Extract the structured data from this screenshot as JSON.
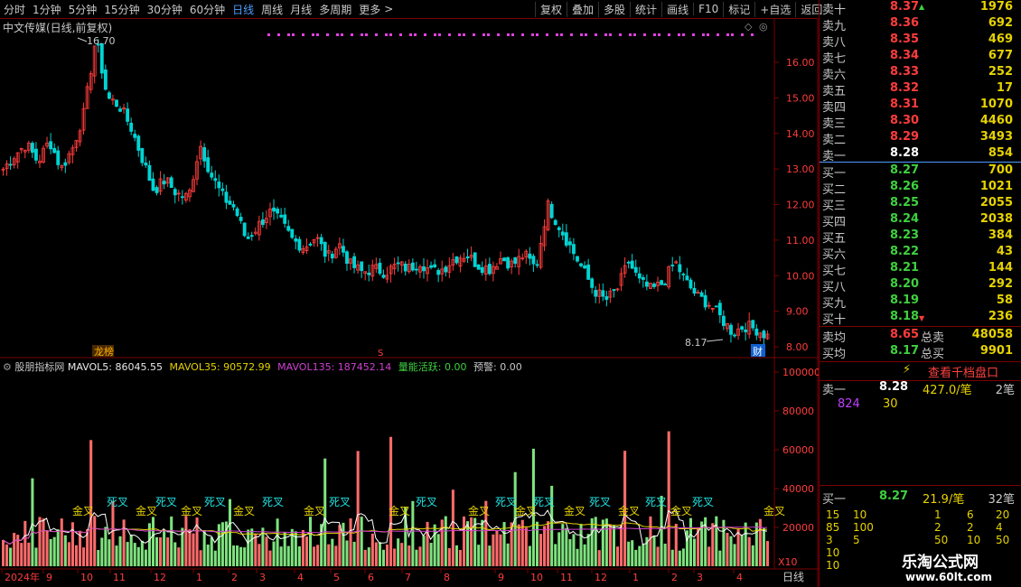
{
  "toolbar": {
    "periods": [
      "分时",
      "1分钟",
      "5分钟",
      "15分钟",
      "30分钟",
      "60分钟",
      "日线",
      "周线",
      "月线",
      "多周期",
      "更多"
    ],
    "active_period": "日线",
    "tools": [
      "复权",
      "叠加",
      "多股",
      "统计",
      "画线",
      "F10",
      "标记",
      "+自选",
      "返回"
    ]
  },
  "kline": {
    "title": "中文传媒(日线,前复权)",
    "max_label": "16.70",
    "min_label": "8.17",
    "badge_left": "龙榜",
    "badge_fin": "财",
    "badge_s": "S"
  },
  "indicator": {
    "name": "股朋指标网",
    "mavol5_label": "MAVOL5:",
    "mavol5": "86045.55",
    "mavol35_label": "MAVOL35:",
    "mavol35": "90572.99",
    "mavol135_label": "MAVOL135:",
    "mavol135": "187452.14",
    "active_label": "量能活跃:",
    "active": "0.00",
    "warn_label": "预警:",
    "warn": "0.00",
    "unit": "X10",
    "cross_gold": "金叉",
    "cross_dead": "死叉"
  },
  "axis": {
    "price_ticks": [
      "16.00",
      "15.00",
      "14.00",
      "13.00",
      "12.00",
      "11.00",
      "10.00",
      "9.00",
      "8.00"
    ],
    "vol_ticks": [
      "100000",
      "80000",
      "60000",
      "40000",
      "20000"
    ],
    "months": [
      "2024年",
      "9",
      "10",
      "11",
      "12",
      "1",
      "2",
      "3",
      "4",
      "5",
      "6",
      "7",
      "8",
      "9",
      "10",
      "11",
      "12",
      "1",
      "2",
      "3",
      "4"
    ],
    "bottom_label": "日线"
  },
  "orderbook": {
    "asks": [
      {
        "label": "卖十",
        "price": "8.37",
        "vol": "1976"
      },
      {
        "label": "卖九",
        "price": "8.36",
        "vol": "692"
      },
      {
        "label": "卖八",
        "price": "8.35",
        "vol": "469"
      },
      {
        "label": "卖七",
        "price": "8.34",
        "vol": "677"
      },
      {
        "label": "卖六",
        "price": "8.33",
        "vol": "252"
      },
      {
        "label": "卖五",
        "price": "8.32",
        "vol": "17"
      },
      {
        "label": "卖四",
        "price": "8.31",
        "vol": "1070"
      },
      {
        "label": "卖三",
        "price": "8.30",
        "vol": "4460"
      },
      {
        "label": "卖二",
        "price": "8.29",
        "vol": "3493"
      },
      {
        "label": "卖一",
        "price": "8.28",
        "vol": "854"
      }
    ],
    "bids": [
      {
        "label": "买一",
        "price": "8.27",
        "vol": "700"
      },
      {
        "label": "买二",
        "price": "8.26",
        "vol": "1021"
      },
      {
        "label": "买三",
        "price": "8.25",
        "vol": "2055"
      },
      {
        "label": "买四",
        "price": "8.24",
        "vol": "2038"
      },
      {
        "label": "买五",
        "price": "8.23",
        "vol": "384"
      },
      {
        "label": "买六",
        "price": "8.22",
        "vol": "43"
      },
      {
        "label": "买七",
        "price": "8.21",
        "vol": "144"
      },
      {
        "label": "买八",
        "price": "8.20",
        "vol": "292"
      },
      {
        "label": "买九",
        "price": "8.19",
        "vol": "58"
      },
      {
        "label": "买十",
        "price": "8.18",
        "vol": "236"
      }
    ],
    "avg_ask_label": "卖均",
    "avg_ask": "8.65",
    "total_ask_label": "总卖",
    "total_ask": "48058",
    "avg_bid_label": "买均",
    "avg_bid": "8.17",
    "total_bid_label": "总买",
    "total_bid": "9901",
    "look_button": "查看千档盘口",
    "sell1_label": "卖一",
    "sell1_price": "8.28",
    "sell1_detail": "427.0/笔",
    "sell1_count": "2笔",
    "sell1_q1": "824",
    "sell1_q2": "30",
    "buy1_label": "买一",
    "buy1_price": "8.27",
    "buy1_detail": "21.9/笔",
    "buy1_count": "32笔"
  },
  "ticks": [
    [
      "15",
      "10",
      "1",
      "6",
      "20"
    ],
    [
      "85",
      "100",
      "2",
      "2",
      "4"
    ],
    [
      "3",
      "5",
      "50",
      "10",
      "50"
    ],
    [
      "10"
    ],
    [
      "10"
    ]
  ],
  "watermark": {
    "name": "乐淘公式网",
    "url": "www.60lt.com"
  },
  "colors": {
    "up": "#ff3c3c",
    "down": "#00d4d4",
    "volup": "#ff6b6b",
    "voldown": "#7ee37e",
    "accent": "#4f9cff",
    "frame": "#7a0000"
  },
  "chart_data": {
    "type": "bar",
    "kline_close_path": [
      13.0,
      13.4,
      13.7,
      13.2,
      13.8,
      13.0,
      13.6,
      14.6,
      16.7,
      15.0,
      14.8,
      14.2,
      13.3,
      12.4,
      12.7,
      12.3,
      12.2,
      13.7,
      12.8,
      12.2,
      11.9,
      11.0,
      11.4,
      11.8,
      11.5,
      11.0,
      10.8,
      11.1,
      10.5,
      10.9,
      10.3,
      10.1,
      10.2,
      10.1,
      10.3,
      10.2,
      10.4,
      10.1,
      10.2,
      10.5,
      10.6,
      10.3,
      10.2,
      10.5,
      10.3,
      10.6,
      10.2,
      12.0,
      11.4,
      10.8,
      10.2,
      9.6,
      9.3,
      9.6,
      10.4,
      9.8,
      9.6,
      9.8,
      10.4,
      9.8,
      9.4,
      9.2,
      8.8,
      8.4,
      8.6,
      8.5,
      8.3
    ],
    "volume_ticks": [
      100000,
      80000,
      60000,
      40000,
      20000
    ]
  }
}
